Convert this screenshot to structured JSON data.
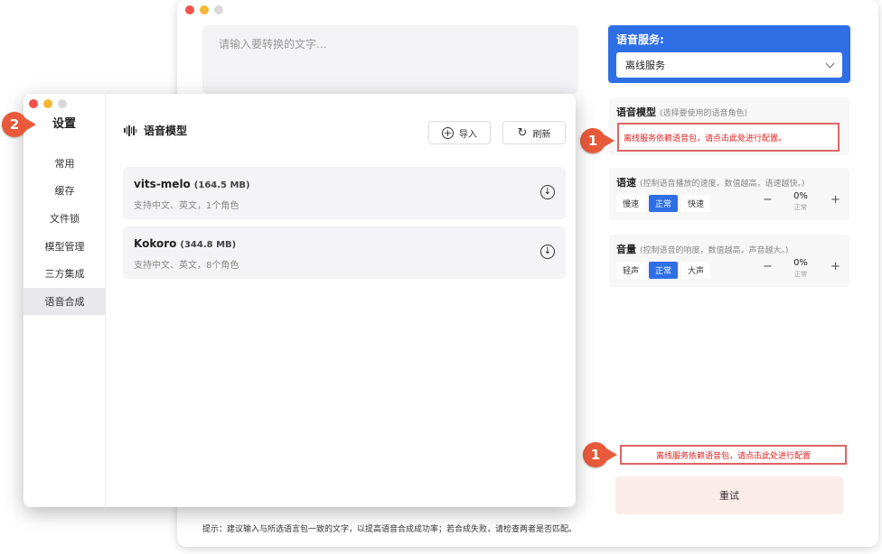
{
  "main": {
    "input_placeholder": "请输入要转换的文字...",
    "tip": "提示：建议输入与所选语言包一致的文字，以提高语音合成成功率；若合成失败，请检查两者是否匹配。",
    "retry_label": "重试",
    "bottom_warning": "离线服务依赖语音包，请点击此处进行配置"
  },
  "voice_service": {
    "label": "语音服务:",
    "selected": "离线服务"
  },
  "voice_model": {
    "title": "语音模型",
    "hint": "(选择要使用的语音角色)",
    "warning": "离线服务依赖语音包，请点击此处进行配置。"
  },
  "speed": {
    "title": "语速",
    "hint": "(控制语音播放的速度，数值越高，语速越快。)",
    "options": [
      "慢速",
      "正常",
      "快速"
    ],
    "value": "0%",
    "sub": "正常"
  },
  "volume": {
    "title": "音量",
    "hint": "(控制语音的响度，数值越高，声音越大。)",
    "options": [
      "轻声",
      "正常",
      "大声"
    ],
    "value": "0%",
    "sub": "正常"
  },
  "badges": {
    "one": "1",
    "two": "2"
  },
  "settings": {
    "title": "设置",
    "nav": [
      "常用",
      "缓存",
      "文件锁",
      "模型管理",
      "三方集成",
      "语音合成"
    ],
    "header_title": "语音模型",
    "import_label": "导入",
    "refresh_label": "刷新",
    "models": [
      {
        "name": "vits-melo",
        "size": "(164.5 MB)",
        "desc": "支持中文、英文，1个角色"
      },
      {
        "name": "Kokoro",
        "size": "(344.8 MB)",
        "desc": "支持中文、英文，8个角色"
      }
    ]
  },
  "colors": {
    "accent": "#2f6fe6",
    "warning": "#e02020",
    "badge": "#e85a3a"
  }
}
